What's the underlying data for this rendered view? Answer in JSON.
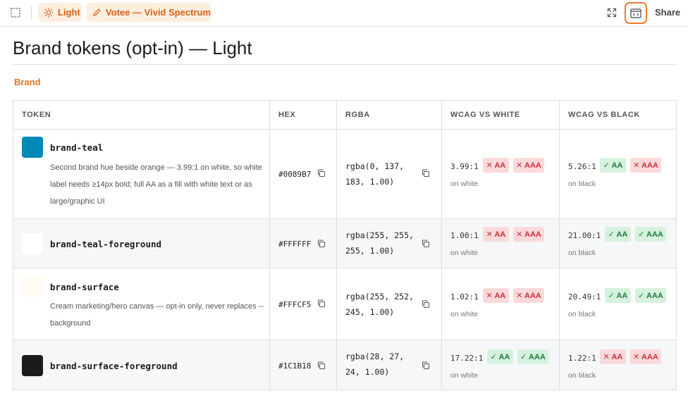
{
  "topbar": {
    "theme_label": "Light",
    "brand_label": "Votee — Vivid Spectrum",
    "share_label": "Share"
  },
  "page": {
    "title": "Brand tokens (opt-in) — Light",
    "section": "Brand"
  },
  "table": {
    "headers": [
      "TOKEN",
      "HEX",
      "RGBA",
      "WCAG VS WHITE",
      "WCAG VS BLACK"
    ],
    "rows": [
      {
        "name": "brand-teal",
        "swatch": "#0089B7",
        "desc": "Second brand hue beside orange — 3.99:1 on white, so white label needs ≥14px bold; full AA as a fill with white text or as large/graphic UI",
        "hex": "#0089B7",
        "rgba_1": "rgba(0, 137,",
        "rgba_2": "183, 1.00)",
        "white": {
          "ratio": "3.99:1",
          "aa": "✕ AA",
          "aaa": "✕ AAA",
          "aa_pass": false,
          "aaa_pass": false,
          "on": "on white"
        },
        "black": {
          "ratio": "5.26:1",
          "aa": "✓ AA",
          "aaa": "✕ AAA",
          "aa_pass": true,
          "aaa_pass": false,
          "on": "on black"
        }
      },
      {
        "name": "brand-teal-foreground",
        "swatch": "#FFFFFF",
        "desc": "",
        "hex": "#FFFFFF",
        "rgba_1": "rgba(255, 255,",
        "rgba_2": "255, 1.00)",
        "white": {
          "ratio": "1.00:1",
          "aa": "✕ AA",
          "aaa": "✕ AAA",
          "aa_pass": false,
          "aaa_pass": false,
          "on": "on white"
        },
        "black": {
          "ratio": "21.00:1",
          "aa": "✓ AA",
          "aaa": "✓ AAA",
          "aa_pass": true,
          "aaa_pass": true,
          "on": "on black"
        }
      },
      {
        "name": "brand-surface",
        "swatch": "#FFFCF5",
        "desc": "Cream marketing/hero canvas — opt-in only, never replaces --background",
        "hex": "#FFFCF5",
        "rgba_1": "rgba(255, 252,",
        "rgba_2": "245, 1.00)",
        "white": {
          "ratio": "1.02:1",
          "aa": "✕ AA",
          "aaa": "✕ AAA",
          "aa_pass": false,
          "aaa_pass": false,
          "on": "on white"
        },
        "black": {
          "ratio": "20.49:1",
          "aa": "✓ AA",
          "aaa": "✓ AAA",
          "aa_pass": true,
          "aaa_pass": true,
          "on": "on black"
        }
      },
      {
        "name": "brand-surface-foreground",
        "swatch": "#1C1B18",
        "desc": "",
        "hex": "#1C1B18",
        "rgba_1": "rgba(28, 27,",
        "rgba_2": "24, 1.00)",
        "white": {
          "ratio": "17.22:1",
          "aa": "✓ AA",
          "aaa": "✓ AAA",
          "aa_pass": true,
          "aaa_pass": true,
          "on": "on white"
        },
        "black": {
          "ratio": "1.22:1",
          "aa": "✕ AA",
          "aaa": "✕ AAA",
          "aa_pass": false,
          "aaa_pass": false,
          "on": "on black"
        }
      }
    ]
  },
  "colors": {
    "accent": "#E8731F",
    "pill_bg": "#FDEEE0",
    "pass_bg": "#D7F1DF",
    "fail_bg": "#FBD9DB"
  },
  "icons": {
    "select": "select-frame-icon",
    "theme": "sun-icon",
    "brand": "pencil-icon",
    "expand": "expand-icon",
    "code": "code-window-icon",
    "copy": "copy-icon"
  }
}
